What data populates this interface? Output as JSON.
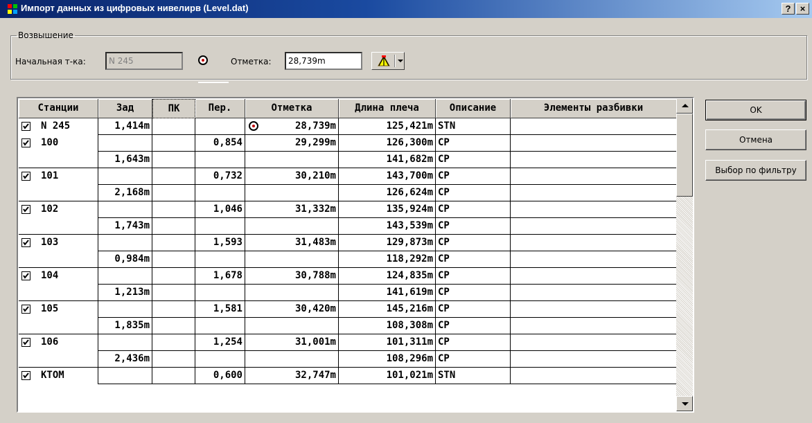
{
  "window": {
    "title": "Импорт данных из цифровых нивелирв (Level.dat)",
    "help_button": "?",
    "close_button": "×"
  },
  "elevation_group": {
    "legend": "Возвышение",
    "start_point_label": "Начальная т-ка:",
    "start_point_value": "N 245",
    "mark_label": "Отметка:",
    "mark_value": "28,739m",
    "tool_icon": "level-tripod-icon"
  },
  "table": {
    "columns": [
      "Станции",
      "Зад",
      "ПК",
      "Пер.",
      "Отметка",
      "Длина плеча",
      "Описание",
      "Элементы разбивки"
    ],
    "rows": [
      {
        "checked": true,
        "station": "N 245",
        "back": "1,414m",
        "pk": "",
        "fore": "",
        "mark": "28,739m",
        "benchmark": true,
        "length": "125,421m",
        "desc": "STN",
        "elements": ""
      },
      {
        "checked": true,
        "station": "100",
        "back": "",
        "pk": "",
        "fore": "0,854",
        "mark": "29,299m",
        "benchmark": false,
        "length": "126,300m",
        "desc": "CP",
        "elements": ""
      },
      {
        "checked": false,
        "station": "",
        "back": "1,643m",
        "pk": "",
        "fore": "",
        "mark": "",
        "benchmark": false,
        "length": "141,682m",
        "desc": "CP",
        "elements": ""
      },
      {
        "checked": true,
        "station": "101",
        "back": "",
        "pk": "",
        "fore": "0,732",
        "mark": "30,210m",
        "benchmark": false,
        "length": "143,700m",
        "desc": "CP",
        "elements": ""
      },
      {
        "checked": false,
        "station": "",
        "back": "2,168m",
        "pk": "",
        "fore": "",
        "mark": "",
        "benchmark": false,
        "length": "126,624m",
        "desc": "CP",
        "elements": ""
      },
      {
        "checked": true,
        "station": "102",
        "back": "",
        "pk": "",
        "fore": "1,046",
        "mark": "31,332m",
        "benchmark": false,
        "length": "135,924m",
        "desc": "CP",
        "elements": ""
      },
      {
        "checked": false,
        "station": "",
        "back": "1,743m",
        "pk": "",
        "fore": "",
        "mark": "",
        "benchmark": false,
        "length": "143,539m",
        "desc": "CP",
        "elements": ""
      },
      {
        "checked": true,
        "station": "103",
        "back": "",
        "pk": "",
        "fore": "1,593",
        "mark": "31,483m",
        "benchmark": false,
        "length": "129,873m",
        "desc": "CP",
        "elements": ""
      },
      {
        "checked": false,
        "station": "",
        "back": "0,984m",
        "pk": "",
        "fore": "",
        "mark": "",
        "benchmark": false,
        "length": "118,292m",
        "desc": "CP",
        "elements": ""
      },
      {
        "checked": true,
        "station": "104",
        "back": "",
        "pk": "",
        "fore": "1,678",
        "mark": "30,788m",
        "benchmark": false,
        "length": "124,835m",
        "desc": "CP",
        "elements": ""
      },
      {
        "checked": false,
        "station": "",
        "back": "1,213m",
        "pk": "",
        "fore": "",
        "mark": "",
        "benchmark": false,
        "length": "141,619m",
        "desc": "CP",
        "elements": ""
      },
      {
        "checked": true,
        "station": "105",
        "back": "",
        "pk": "",
        "fore": "1,581",
        "mark": "30,420m",
        "benchmark": false,
        "length": "145,216m",
        "desc": "CP",
        "elements": ""
      },
      {
        "checked": false,
        "station": "",
        "back": "1,835m",
        "pk": "",
        "fore": "",
        "mark": "",
        "benchmark": false,
        "length": "108,308m",
        "desc": "CP",
        "elements": ""
      },
      {
        "checked": true,
        "station": "106",
        "back": "",
        "pk": "",
        "fore": "1,254",
        "mark": "31,001m",
        "benchmark": false,
        "length": "101,311m",
        "desc": "CP",
        "elements": ""
      },
      {
        "checked": false,
        "station": "",
        "back": "2,436m",
        "pk": "",
        "fore": "",
        "mark": "",
        "benchmark": false,
        "length": "108,296m",
        "desc": "CP",
        "elements": ""
      },
      {
        "checked": true,
        "station": "KTOM",
        "back": "",
        "pk": "",
        "fore": "0,600",
        "mark": "32,747m",
        "benchmark": false,
        "length": "101,021m",
        "desc": "STN",
        "elements": ""
      }
    ]
  },
  "buttons": {
    "ok": "OK",
    "cancel": "Отмена",
    "filter": "Выбор по фильтру"
  },
  "colors": {
    "titlebar_start": "#0a246a",
    "titlebar_end": "#a6caf0",
    "dialog_face": "#d4d0c8",
    "benchmark_dot": "#c00000"
  }
}
